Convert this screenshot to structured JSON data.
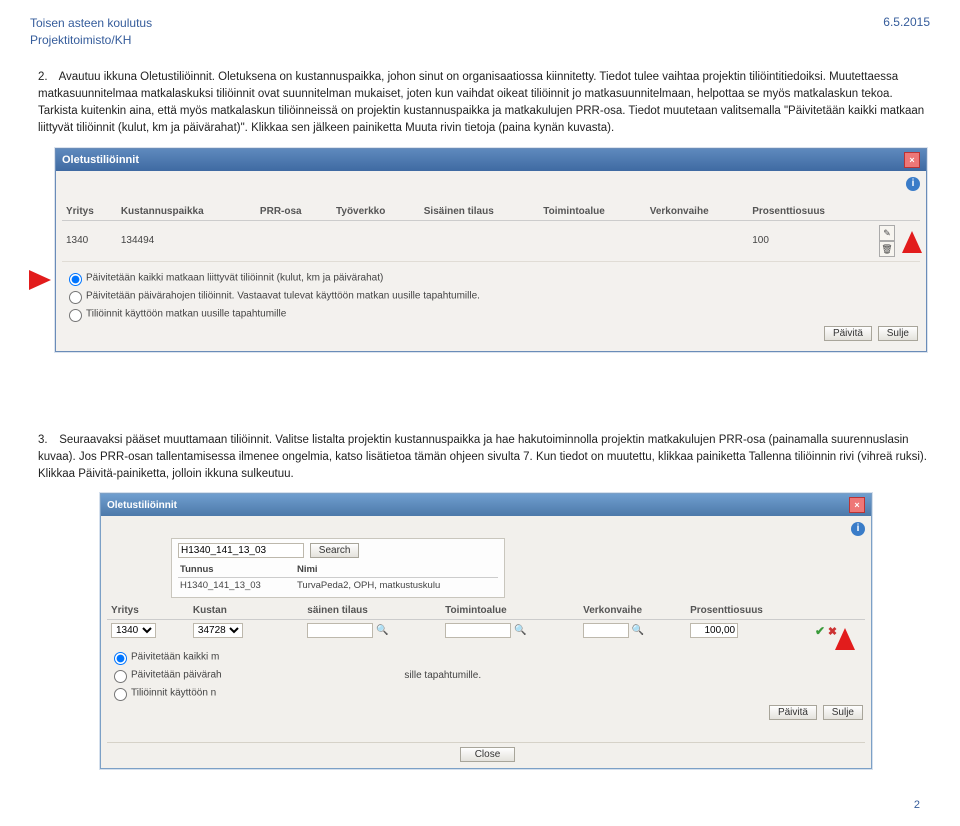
{
  "header": {
    "org1": "Toisen asteen koulutus",
    "org2": "Projektitoimisto/KH",
    "date": "6.5.2015"
  },
  "para1": {
    "num": "2.",
    "text": "Avautuu ikkuna Oletustiliöinnit. Oletuksena on kustannuspaikka, johon sinut on organisaatiossa kiinnitetty. Tiedot tulee vaihtaa projektin tiliöintitiedoiksi. Muutettaessa matkasuunnitelmaa matkalaskuksi tiliöinnit ovat suunnitelman mukaiset, joten kun vaihdat oikeat tiliöinnit jo matkasuunnitelmaan, helpottaa se myös matkalaskun tekoa. Tarkista kuitenkin aina, että myös matkalaskun tiliöinneissä on projektin kustannuspaikka ja matkakulujen PRR-osa. Tiedot muutetaan valitsemalla \"Päivitetään kaikki matkaan liittyvät tiliöinnit (kulut, km ja päivärahat)\". Klikkaa sen jälkeen painiketta Muuta rivin tietoja (paina kynän kuvasta)."
  },
  "dlg1": {
    "title": "Oletustiliöinnit",
    "cols": [
      "Yritys",
      "Kustannuspaikka",
      "PRR-osa",
      "Työverkko",
      "Sisäinen tilaus",
      "Toimintoalue",
      "Verkonvaihe",
      "Prosenttiosuus",
      ""
    ],
    "row": {
      "yritys": "1340",
      "kust": "134494",
      "prr": "",
      "tv": "",
      "st": "",
      "ta": "",
      "vk": "",
      "pros": "100"
    },
    "opts": {
      "o1": "Päivitetään kaikki matkaan liittyvät tiliöinnit (kulut, km ja päivärahat)",
      "o2": "Päivitetään päivärahojen tiliöinnit. Vastaavat tulevat käyttöön matkan uusille tapahtumille.",
      "o3": "Tiliöinnit käyttöön matkan uusille tapahtumille"
    },
    "btn_update": "Päivitä",
    "btn_close": "Sulje"
  },
  "para2": {
    "num": "3.",
    "text": "Seuraavaksi pääset muuttamaan tiliöinnit. Valitse listalta projektin kustannuspaikka ja hae hakutoiminnolla projektin matkakulujen PRR-osa (painamalla suurennuslasin kuvaa). Jos PRR-osan tallentamisessa ilmenee ongelmia, katso lisätietoa tämän ohjeen sivulta 7. Kun tiedot on muutettu, klikkaa painiketta Tallenna tiliöinnin rivi (vihreä ruksi). Klikkaa Päivitä-painiketta, jolloin ikkuna sulkeutuu."
  },
  "dlg2": {
    "title": "Oletustiliöinnit",
    "search_val": "H1340_141_13_03",
    "search_btn": "Search",
    "scol": [
      "Tunnus",
      "Nimi"
    ],
    "srow": {
      "tunnus": "H1340_141_13_03",
      "nimi": "TurvaPeda2, OPH, matkustuskulu"
    },
    "cols": [
      "Yritys",
      "Kustan",
      "",
      "",
      "säinen tilaus",
      "Toimintoalue",
      "Verkonvaihe",
      "Prosenttiosuus",
      ""
    ],
    "row": {
      "yritys": "1340",
      "kust": "34728",
      "pros": "100,00"
    },
    "btn_update": "Päivitä",
    "btn_close": "Sulje",
    "btn_close2": "Close",
    "opts": {
      "o1": "Päivitetään kaikki m",
      "o2": "Päivitetään päivärah",
      "o3": "Tiliöinnit käyttöön n",
      "tail": "sille tapahtumille."
    }
  },
  "footer": {
    "page": "2"
  }
}
